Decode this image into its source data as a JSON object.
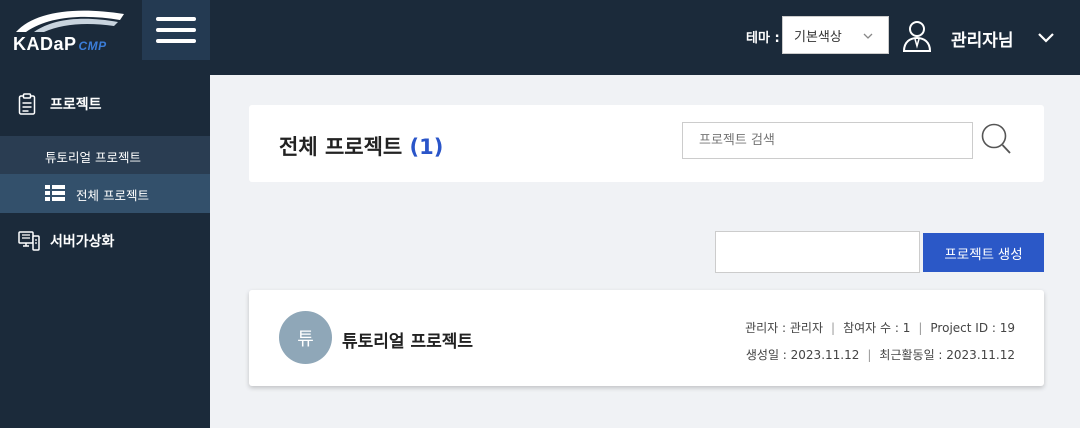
{
  "header": {
    "logo_text": "KADaP",
    "logo_suffix": "CMP",
    "theme_label": "테마 :",
    "theme_value": "기본색상",
    "user_name": "관리자님"
  },
  "sidebar": {
    "items": [
      {
        "label": "프로젝트",
        "icon": "clipboard-icon"
      },
      {
        "label": "서버가상화",
        "icon": "server-icon"
      }
    ],
    "sub_items": [
      {
        "label": "튜토리얼 프로젝트"
      },
      {
        "label": "전체 프로젝트",
        "icon": "list-icon"
      }
    ]
  },
  "main": {
    "title": "전체 프로젝트",
    "count": "(1)",
    "search_placeholder": "프로젝트 검색",
    "create_button": "프로젝트 생성",
    "projects": [
      {
        "avatar": "튜",
        "name": "튜토리얼 프로젝트",
        "manager": "관리자 : 관리자",
        "members": "참여자 수 : 1",
        "project_id": "Project ID : 19",
        "created": "생성일 : 2023.11.12",
        "last_active": "최근활동일 : 2023.11.12"
      }
    ]
  },
  "colors": {
    "header_bg": "#1b2a3a",
    "accent": "#2b58c7",
    "avatar_bg": "#8fa7b8"
  }
}
